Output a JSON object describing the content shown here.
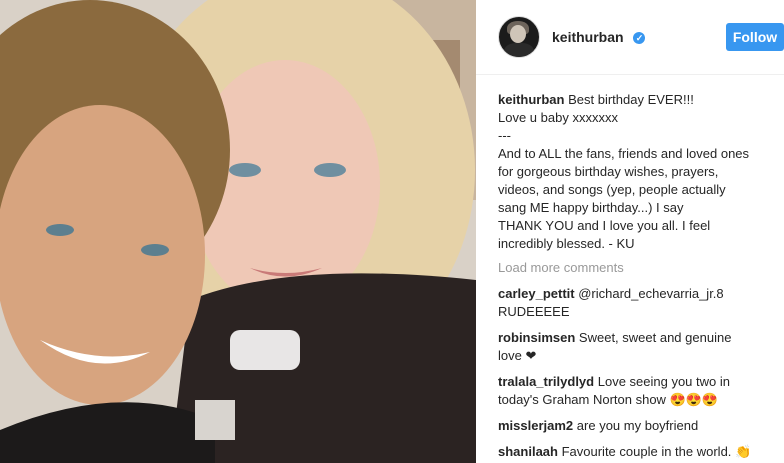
{
  "post": {
    "username": "keithurban",
    "verified_icon": "verified-badge-icon",
    "follow_label": "Follow"
  },
  "caption": {
    "username": "keithurban",
    "lines": [
      "Best birthday EVER!!!",
      "Love u baby xxxxxxx",
      "---",
      "And to ALL the fans, friends and loved ones",
      "for gorgeous birthday wishes, prayers,",
      "videos, and songs (yep, people actually",
      "sang ME happy birthday...) I say",
      "THANK YOU and I love you all. I feel",
      "incredibly blessed. - KU"
    ]
  },
  "load_more": "Load more comments",
  "comments": [
    {
      "user": "carley_pettit",
      "text": "@richard_echevarria_jr.8",
      "text2": "RUDEEEEE"
    },
    {
      "user": "robinsimsen",
      "text": "Sweet, sweet and genuine",
      "text2": "love ❤"
    },
    {
      "user": "tralala_trilydlyd",
      "text": "Love seeing you two in",
      "text2": "today's Graham Norton show 😍😍😍"
    },
    {
      "user": "misslerjam2",
      "text": "are you my boyfriend",
      "text2": ""
    },
    {
      "user": "shanilaah",
      "text": "Favourite couple in the world. 👏",
      "text2": ""
    }
  ],
  "colors": {
    "accent": "#3897f0",
    "muted": "#999999",
    "text": "#262626"
  }
}
